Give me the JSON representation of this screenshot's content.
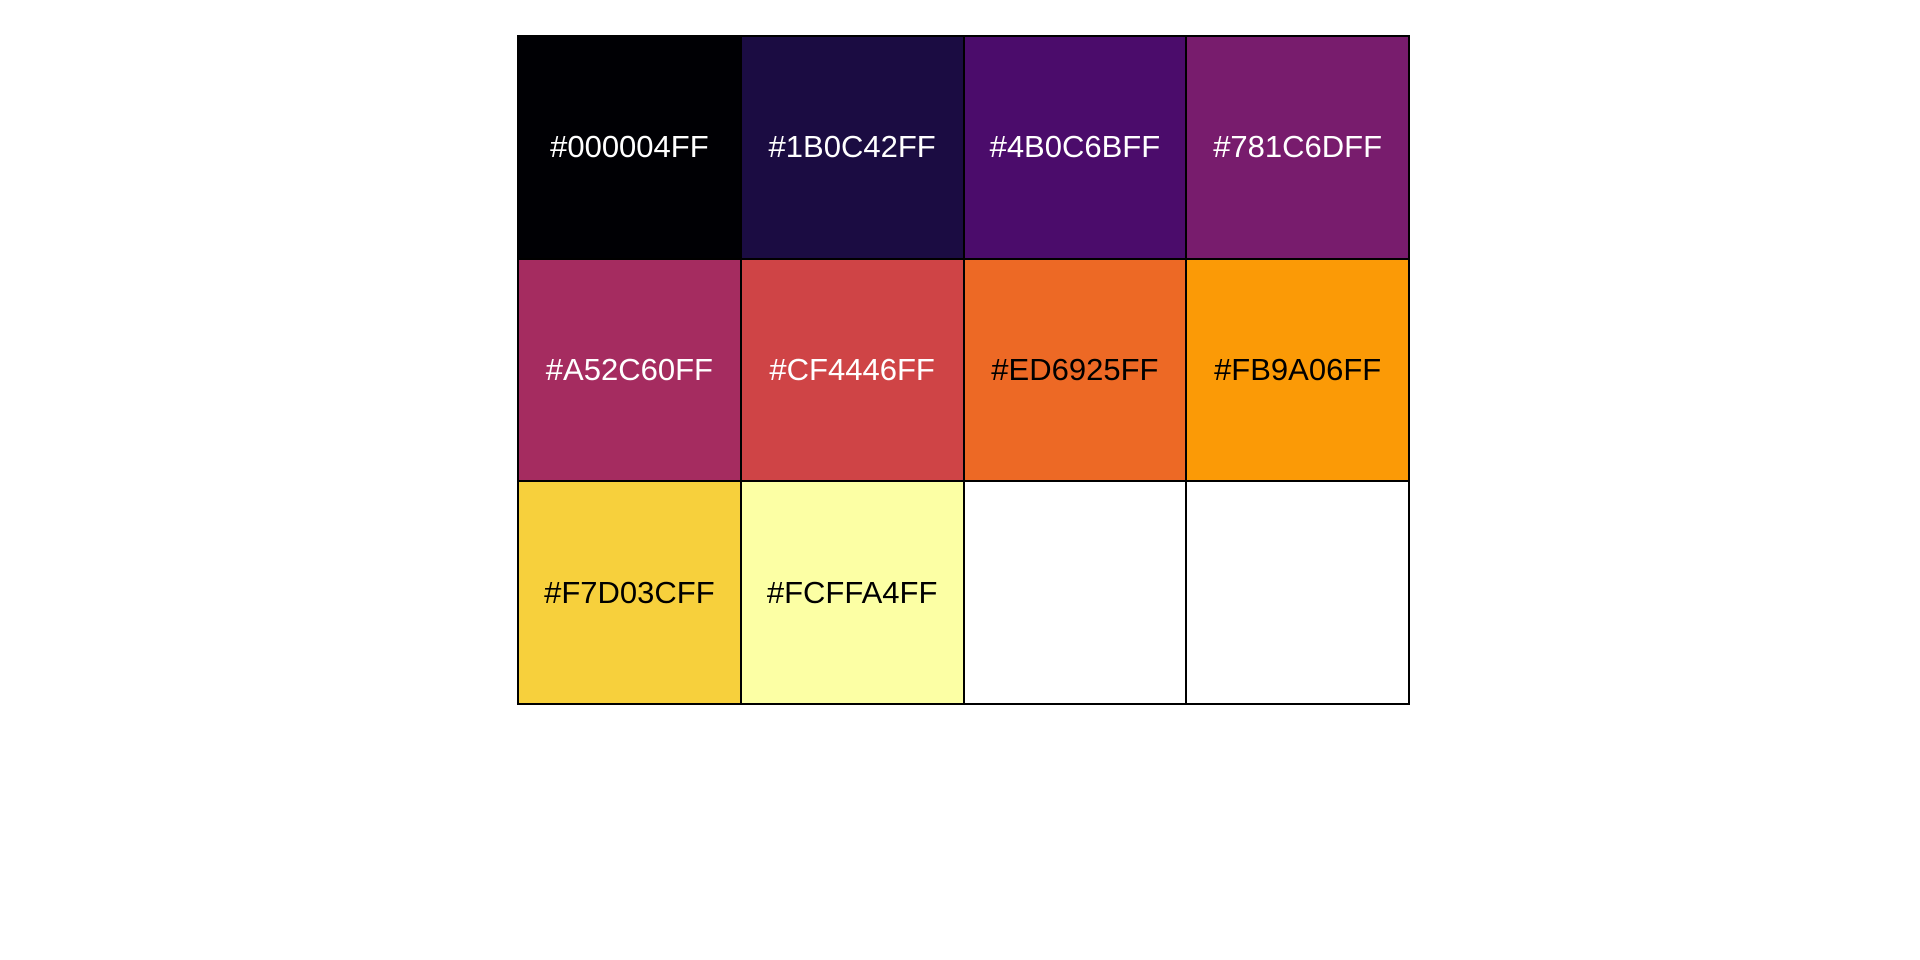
{
  "swatches": [
    {
      "label": "#000004FF",
      "color": "#000004",
      "text_color": "#ffffff"
    },
    {
      "label": "#1B0C42FF",
      "color": "#1B0C42",
      "text_color": "#ffffff"
    },
    {
      "label": "#4B0C6BFF",
      "color": "#4B0C6B",
      "text_color": "#ffffff"
    },
    {
      "label": "#781C6DFF",
      "color": "#781C6D",
      "text_color": "#ffffff"
    },
    {
      "label": "#A52C60FF",
      "color": "#A52C60",
      "text_color": "#ffffff"
    },
    {
      "label": "#CF4446FF",
      "color": "#CF4446",
      "text_color": "#ffffff"
    },
    {
      "label": "#ED6925FF",
      "color": "#ED6925",
      "text_color": "#000000"
    },
    {
      "label": "#FB9A06FF",
      "color": "#FB9A06",
      "text_color": "#000000"
    },
    {
      "label": "#F7D03CFF",
      "color": "#F7D03C",
      "text_color": "#000000"
    },
    {
      "label": "#FCFFA4FF",
      "color": "#FCFFA4",
      "text_color": "#000000"
    },
    {
      "label": "",
      "color": "#FFFFFF",
      "text_color": "#000000"
    },
    {
      "label": "",
      "color": "#FFFFFF",
      "text_color": "#000000"
    }
  ]
}
